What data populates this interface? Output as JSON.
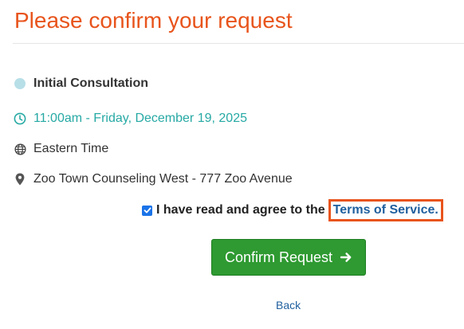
{
  "header": {
    "title": "Please confirm your request"
  },
  "appointment": {
    "service": "Initial Consultation",
    "datetime": "11:00am - Friday, December 19, 2025",
    "timezone": "Eastern Time",
    "location": "Zoo Town Counseling West - 777 Zoo Avenue"
  },
  "agreement": {
    "checked": true,
    "label": "I have read and agree to the",
    "link_text": "Terms of Service."
  },
  "actions": {
    "confirm_label": "Confirm Request",
    "back_label": "Back"
  },
  "colors": {
    "title": "#e8541c",
    "service_dot": "#b7dfe8",
    "time_text": "#26a9a4",
    "confirm_button": "#2e9a31",
    "checkbox": "#1a73e8",
    "highlight_box": "#e8541c"
  },
  "icons": {
    "service": "circle-dot-icon",
    "time": "clock-icon",
    "timezone": "globe-icon",
    "location": "map-marker-icon",
    "confirm": "arrow-right-icon"
  }
}
